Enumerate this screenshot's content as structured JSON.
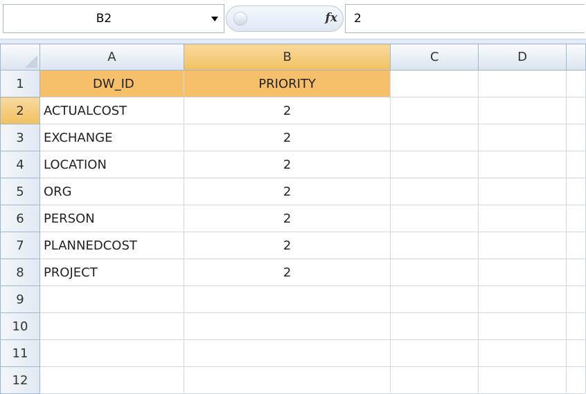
{
  "formula_bar": {
    "name_box": "B2",
    "fx_label": "fx",
    "formula_value": "2"
  },
  "columns": [
    "A",
    "B",
    "C",
    "D"
  ],
  "rows": [
    {
      "num": "1",
      "a": "DW_ID",
      "b": "PRIORITY"
    },
    {
      "num": "2",
      "a": "ACTUALCOST",
      "b": "2"
    },
    {
      "num": "3",
      "a": "EXCHANGE",
      "b": "2"
    },
    {
      "num": "4",
      "a": "LOCATION",
      "b": "2"
    },
    {
      "num": "5",
      "a": "ORG",
      "b": "2"
    },
    {
      "num": "6",
      "a": "PERSON",
      "b": "2"
    },
    {
      "num": "7",
      "a": "PLANNEDCOST",
      "b": "2"
    },
    {
      "num": "8",
      "a": "PROJECT",
      "b": "2"
    },
    {
      "num": "9",
      "a": "",
      "b": ""
    },
    {
      "num": "10",
      "a": "",
      "b": ""
    },
    {
      "num": "11",
      "a": "",
      "b": ""
    },
    {
      "num": "12",
      "a": "",
      "b": ""
    }
  ],
  "colors": {
    "header_fill": "#f7bf6a",
    "selected_header": "#f1c15f",
    "gridline": "#d0d7e5"
  }
}
